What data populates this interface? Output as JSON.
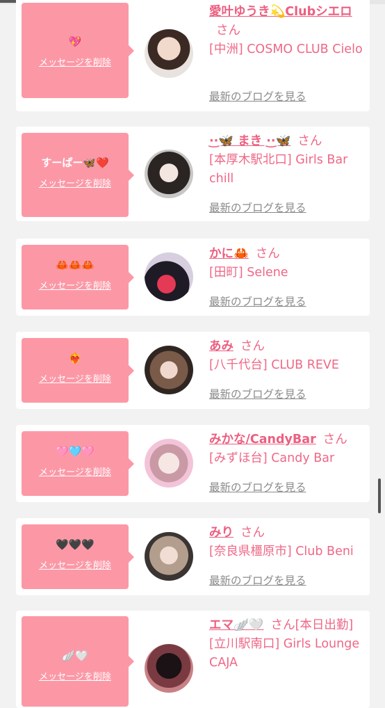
{
  "delete_label": "メッセージを削除",
  "san": "さん",
  "blog_label": "最新のブログを見る",
  "colors": {
    "accent_pink": "#fc98a6",
    "name_pink": "#ec5f80",
    "background": "#f2f2f2"
  },
  "entries": [
    {
      "message": "💖",
      "name": "愛叶ゆうき💫Clubシエロ",
      "shop": "[中洲] COSMO CLUB Cielo"
    },
    {
      "message": "すーぱー🦋❤️",
      "name": "·͜·🦋 まき ·͜·🦋",
      "shop": "[本厚木駅北口] Girls Bar chill"
    },
    {
      "message": "🦀🦀🦀",
      "name": "かに🦀",
      "shop": "[田町] Selene"
    },
    {
      "message": "❤️‍🔥",
      "name": "あみ",
      "shop": "[八千代台] CLUB REVE"
    },
    {
      "message": "🩷🩵🩷",
      "name": "みかな/CandyBar",
      "shop": "[みずほ台] Candy Bar"
    },
    {
      "message": "🖤🖤🖤",
      "name": "みり",
      "shop": "[奈良県橿原市] Club Beni"
    },
    {
      "message": "🪽🤍",
      "name": "エマ🪽🤍",
      "name_suffix": "[本日出勤]",
      "shop": "[立川駅南口] Girls Lounge CAJA"
    }
  ]
}
